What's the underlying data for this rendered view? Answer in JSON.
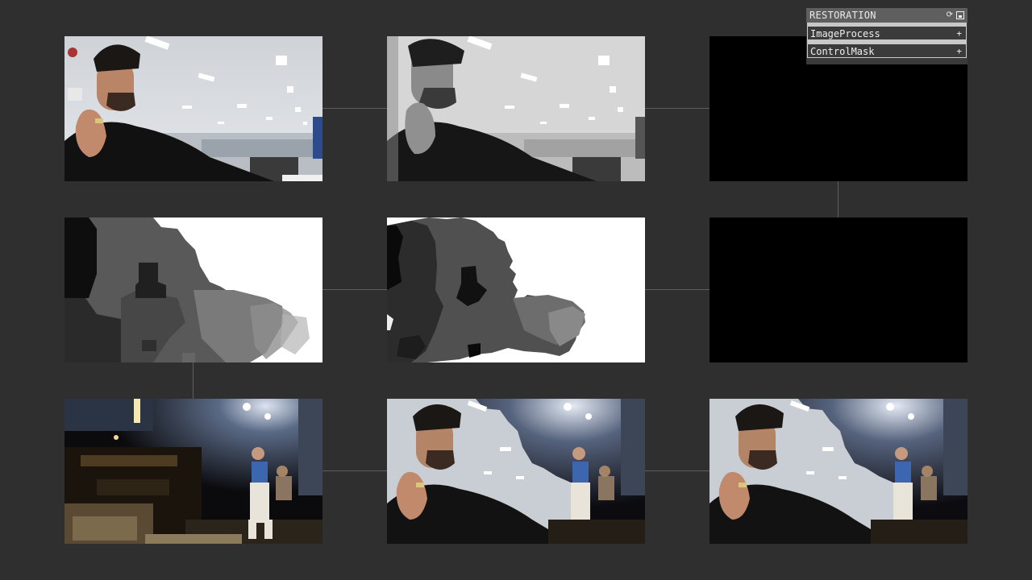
{
  "panel": {
    "title": "RESTORATION",
    "folders": [
      {
        "label": "ImageProcess",
        "toggle": "+"
      },
      {
        "label": "ControlMask",
        "toggle": "+"
      }
    ],
    "icons": [
      "refresh-icon",
      "save-icon"
    ]
  },
  "tiles": [
    {
      "id": "camera-input",
      "content": "photo: man at office desk (color)"
    },
    {
      "id": "grayscale",
      "content": "photo: man at office desk (grayscale)"
    },
    {
      "id": "black-output-1",
      "content": "black"
    },
    {
      "id": "depth-blur",
      "content": "gray blurred mask"
    },
    {
      "id": "depth-segment",
      "content": "gray segmented mask"
    },
    {
      "id": "black-output-2",
      "content": "black"
    },
    {
      "id": "concert-video",
      "content": "photo: concert stage performer"
    },
    {
      "id": "composite-1",
      "content": "composite of office and stage"
    },
    {
      "id": "composite-2",
      "content": "composite of office and stage"
    }
  ],
  "colors": {
    "background": "#2f2f2f",
    "wire": "#5e5e5e",
    "panel_header": "#5f5f5f",
    "folder": "#3b3b3b"
  }
}
